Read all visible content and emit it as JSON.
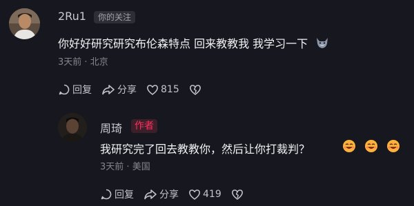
{
  "comment1": {
    "username": "2Ru1",
    "follow_tag": "你的关注",
    "text": "你好好研究研究布伦森特点 回来教教我 我学习一下",
    "time": "3天前",
    "location": "北京",
    "reply_label": "回复",
    "share_label": "分享",
    "like_count": "815",
    "inline_emoji": "wolf-emoji"
  },
  "comment2": {
    "username": "周琦",
    "author_tag": "作者",
    "text": "我研究完了回去教教你，然后让你打裁判？",
    "time": "3天前",
    "location": "美国",
    "reply_label": "回复",
    "share_label": "分享",
    "like_count": "419",
    "emojis": [
      "smile-emoji",
      "smile-emoji",
      "smile-emoji"
    ]
  },
  "separator": "·",
  "colors": {
    "background": "#17171f",
    "author_tag": "#ff2e5e",
    "meta": "#85858d"
  }
}
